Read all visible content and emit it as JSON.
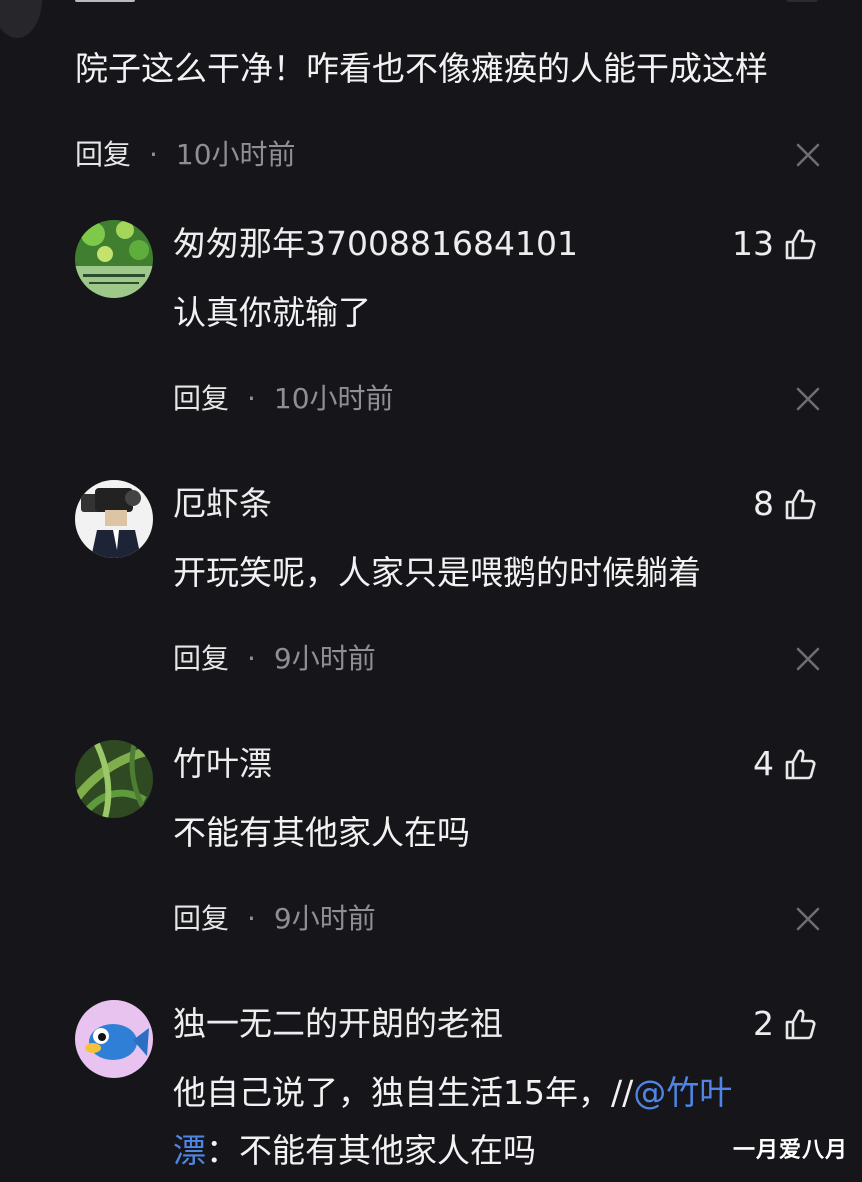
{
  "top_comment": {
    "text": "院子这么干净！咋看也不像瘫痪的人能干成这样",
    "reply_label": "回复",
    "separator": "·",
    "time": "10小时前"
  },
  "comments": [
    {
      "username": "匆匆那年3700881684101",
      "likes": "13",
      "text": "认真你就输了",
      "reply_label": "回复",
      "separator": "·",
      "time": "10小时前"
    },
    {
      "username": "厄虾条",
      "likes": "8",
      "text": "开玩笑呢，人家只是喂鹅的时候躺着",
      "reply_label": "回复",
      "separator": "·",
      "time": "9小时前"
    },
    {
      "username": "竹叶漂",
      "likes": "4",
      "text": "不能有其他家人在吗",
      "reply_label": "回复",
      "separator": "·",
      "time": "9小时前"
    },
    {
      "username": "独一无二的开朗的老祖",
      "likes": "2",
      "text_before_mention": "他自己说了，独自生活15年，//",
      "mention": "@竹叶漂",
      "text_after_mention": "：不能有其他家人在吗"
    }
  ],
  "watermark": "一月爱八月",
  "icons": {
    "like": "thumbs-up-icon",
    "close": "close-icon"
  },
  "colors": {
    "background": "#16161a",
    "mention": "#4f86e6",
    "meta": "#8e8e93"
  }
}
